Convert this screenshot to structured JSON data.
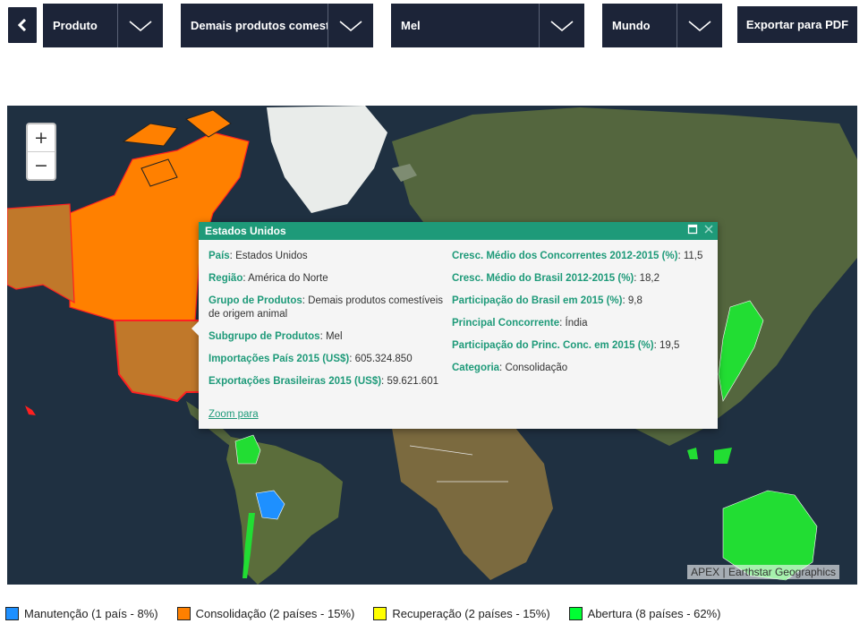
{
  "toolbar": {
    "back_icon": "chevron-left-icon",
    "dropdowns": [
      {
        "name": "product-type",
        "selected": "Produto"
      },
      {
        "name": "product-group",
        "selected": "Demais produtos comestív"
      },
      {
        "name": "product-subgroup",
        "selected": "Mel"
      },
      {
        "name": "region",
        "selected": "Mundo"
      }
    ],
    "export_label": "Exportar para PDF"
  },
  "map": {
    "zoom_in": "+",
    "zoom_out": "−",
    "attribution": "APEX | Earthstar Geographics"
  },
  "popup": {
    "title": "Estados Unidos",
    "left": [
      {
        "k": "País",
        "v": "Estados Unidos"
      },
      {
        "k": "Região",
        "v": "América do Norte"
      },
      {
        "k": "Grupo de Produtos",
        "v": "Demais produtos comestíveis de origem animal"
      },
      {
        "k": "Subgrupo de Produtos",
        "v": "Mel"
      },
      {
        "k": "Importações País 2015 (US$)",
        "v": "605.324.850"
      },
      {
        "k": "Exportações Brasileiras 2015 (US$)",
        "v": "59.621.601"
      }
    ],
    "right": [
      {
        "k": "Cresc. Médio dos Concorrentes 2012-2015 (%)",
        "v": "11,5"
      },
      {
        "k": "Cresc. Médio do Brasil 2012-2015 (%)",
        "v": "18,2"
      },
      {
        "k": "Participação do Brasil em 2015 (%)",
        "v": "9,8"
      },
      {
        "k": "Principal Concorrente",
        "v": "Índia"
      },
      {
        "k": "Participação do Princ. Conc. em 2015 (%)",
        "v": "19,5"
      },
      {
        "k": "Categoria",
        "v": "Consolidação"
      }
    ],
    "zoom_link": "Zoom para"
  },
  "legend": [
    {
      "label": "Manutenção (1 país - 8%)",
      "color": "#1e90ff"
    },
    {
      "label": "Consolidação (2 países - 15%)",
      "color": "#ff8000"
    },
    {
      "label": "Recuperação (2 países - 15%)",
      "color": "#ffff00"
    },
    {
      "label": "Abertura (8 países - 62%)",
      "color": "#00ff33"
    }
  ]
}
